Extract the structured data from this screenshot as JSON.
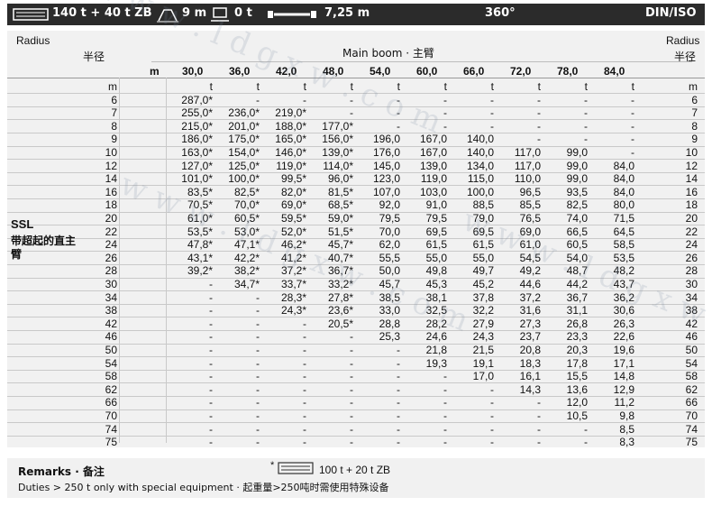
{
  "topbar": {
    "counterweight": "140 t + 40 t ZB",
    "outrigger_span": "9 m",
    "ballast": "0 t",
    "track_width": "7,25 m",
    "slew": "360°",
    "standard": "DIN/ISO"
  },
  "header": {
    "radius_en": "Radius",
    "radius_cn": "半径",
    "main_boom": "Main boom · 主臂",
    "m_label": "m",
    "unit_m": "m",
    "unit_t": "t"
  },
  "boom_lengths": [
    "30,0",
    "36,0",
    "42,0",
    "48,0",
    "54,0",
    "60,0",
    "66,0",
    "72,0",
    "78,0",
    "84,0"
  ],
  "side_label": {
    "code": "SSL",
    "cn": "带超起的直主臂"
  },
  "rows": [
    {
      "r": "6",
      "v": [
        "287,0*",
        "-",
        "-",
        "-",
        "-",
        "-",
        "-",
        "-",
        "-",
        "-"
      ]
    },
    {
      "r": "7",
      "v": [
        "255,0*",
        "236,0*",
        "219,0*",
        "-",
        "-",
        "-",
        "-",
        "-",
        "-",
        "-"
      ]
    },
    {
      "r": "8",
      "v": [
        "215,0*",
        "201,0*",
        "188,0*",
        "177,0*",
        "-",
        "-",
        "-",
        "-",
        "-",
        "-"
      ]
    },
    {
      "r": "9",
      "v": [
        "186,0*",
        "175,0*",
        "165,0*",
        "156,0*",
        "196,0",
        "167,0",
        "140,0",
        "-",
        "-",
        "-"
      ]
    },
    {
      "r": "10",
      "v": [
        "163,0*",
        "154,0*",
        "146,0*",
        "139,0*",
        "176,0",
        "167,0",
        "140,0",
        "117,0",
        "99,0",
        "-"
      ]
    },
    {
      "r": "12",
      "v": [
        "127,0*",
        "125,0*",
        "119,0*",
        "114,0*",
        "145,0",
        "139,0",
        "134,0",
        "117,0",
        "99,0",
        "84,0"
      ]
    },
    {
      "r": "14",
      "v": [
        "101,0*",
        "100,0*",
        "99,5*",
        "96,0*",
        "123,0",
        "119,0",
        "115,0",
        "110,0",
        "99,0",
        "84,0"
      ]
    },
    {
      "r": "16",
      "v": [
        "83,5*",
        "82,5*",
        "82,0*",
        "81,5*",
        "107,0",
        "103,0",
        "100,0",
        "96,5",
        "93,5",
        "84,0"
      ]
    },
    {
      "r": "18",
      "v": [
        "70,5*",
        "70,0*",
        "69,0*",
        "68,5*",
        "92,0",
        "91,0",
        "88,5",
        "85,5",
        "82,5",
        "80,0"
      ]
    },
    {
      "r": "20",
      "v": [
        "61,0*",
        "60,5*",
        "59,5*",
        "59,0*",
        "79,5",
        "79,5",
        "79,0",
        "76,5",
        "74,0",
        "71,5"
      ]
    },
    {
      "r": "22",
      "v": [
        "53,5*",
        "53,0*",
        "52,0*",
        "51,5*",
        "70,0",
        "69,5",
        "69,5",
        "69,0",
        "66,5",
        "64,5"
      ]
    },
    {
      "r": "24",
      "v": [
        "47,8*",
        "47,1*",
        "46,2*",
        "45,7*",
        "62,0",
        "61,5",
        "61,5",
        "61,0",
        "60,5",
        "58,5"
      ]
    },
    {
      "r": "26",
      "v": [
        "43,1*",
        "42,2*",
        "41,2*",
        "40,7*",
        "55,5",
        "55,0",
        "55,0",
        "54,5",
        "54,0",
        "53,5"
      ]
    },
    {
      "r": "28",
      "v": [
        "39,2*",
        "38,2*",
        "37,2*",
        "36,7*",
        "50,0",
        "49,8",
        "49,7",
        "49,2",
        "48,7",
        "48,2"
      ]
    },
    {
      "r": "30",
      "v": [
        "-",
        "34,7*",
        "33,7*",
        "33,2*",
        "45,7",
        "45,3",
        "45,2",
        "44,6",
        "44,2",
        "43,7"
      ]
    },
    {
      "r": "34",
      "v": [
        "-",
        "-",
        "28,3*",
        "27,8*",
        "38,5",
        "38,1",
        "37,8",
        "37,2",
        "36,7",
        "36,2"
      ]
    },
    {
      "r": "38",
      "v": [
        "-",
        "-",
        "24,3*",
        "23,6*",
        "33,0",
        "32,5",
        "32,2",
        "31,6",
        "31,1",
        "30,6"
      ]
    },
    {
      "r": "42",
      "v": [
        "-",
        "-",
        "-",
        "20,5*",
        "28,8",
        "28,2",
        "27,9",
        "27,3",
        "26,8",
        "26,3"
      ]
    },
    {
      "r": "46",
      "v": [
        "-",
        "-",
        "-",
        "-",
        "25,3",
        "24,6",
        "24,3",
        "23,7",
        "23,3",
        "22,6"
      ]
    },
    {
      "r": "50",
      "v": [
        "-",
        "-",
        "-",
        "-",
        "-",
        "21,8",
        "21,5",
        "20,8",
        "20,3",
        "19,6"
      ]
    },
    {
      "r": "54",
      "v": [
        "-",
        "-",
        "-",
        "-",
        "-",
        "19,3",
        "19,1",
        "18,3",
        "17,8",
        "17,1"
      ]
    },
    {
      "r": "58",
      "v": [
        "-",
        "-",
        "-",
        "-",
        "-",
        "-",
        "17,0",
        "16,1",
        "15,5",
        "14,8"
      ]
    },
    {
      "r": "62",
      "v": [
        "-",
        "-",
        "-",
        "-",
        "-",
        "-",
        "-",
        "14,3",
        "13,6",
        "12,9"
      ]
    },
    {
      "r": "66",
      "v": [
        "-",
        "-",
        "-",
        "-",
        "-",
        "-",
        "-",
        "-",
        "12,0",
        "11,2"
      ]
    },
    {
      "r": "70",
      "v": [
        "-",
        "-",
        "-",
        "-",
        "-",
        "-",
        "-",
        "-",
        "10,5",
        "9,8"
      ]
    },
    {
      "r": "74",
      "v": [
        "-",
        "-",
        "-",
        "-",
        "-",
        "-",
        "-",
        "-",
        "-",
        "8,5"
      ]
    },
    {
      "r": "75",
      "v": [
        "-",
        "-",
        "-",
        "-",
        "-",
        "-",
        "-",
        "-",
        "-",
        "8,3"
      ]
    }
  ],
  "remarks": {
    "title": "Remarks · 备注",
    "star_note": "100 t + 20 t ZB",
    "duties": "Duties > 250 t only with special equipment · 起重量>250吨时需使用特殊设备"
  },
  "watermark": "w w w . l d g x w . c o m"
}
